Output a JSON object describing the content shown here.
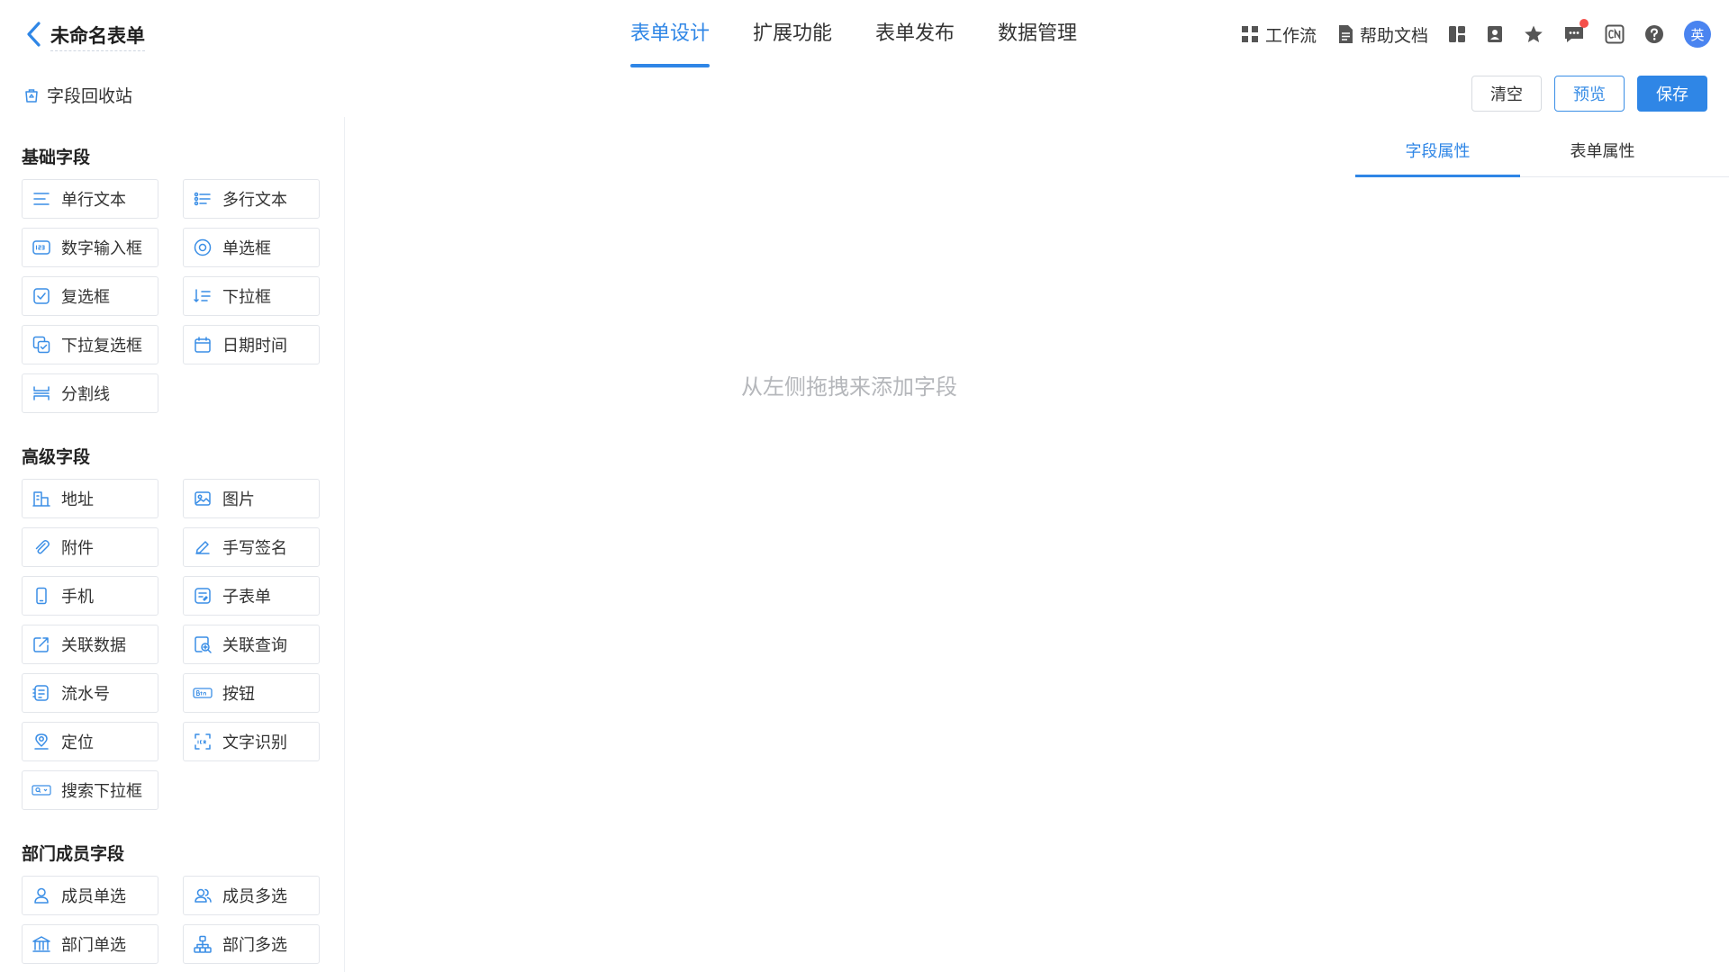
{
  "header": {
    "title": "未命名表单",
    "tabs": [
      "表单设计",
      "扩展功能",
      "表单发布",
      "数据管理"
    ],
    "active_tab": 0,
    "tools": {
      "workflow": "工作流",
      "help_docs": "帮助文档",
      "avatar_text": "英"
    }
  },
  "recycle": {
    "label": "字段回收站"
  },
  "actions": {
    "clear": "清空",
    "preview": "预览",
    "save": "保存"
  },
  "sidebar": {
    "basic_title": "基础字段",
    "basic": [
      {
        "label": "单行文本",
        "icon": "single-line-text-icon"
      },
      {
        "label": "多行文本",
        "icon": "multi-line-text-icon"
      },
      {
        "label": "数字输入框",
        "icon": "number-input-icon"
      },
      {
        "label": "单选框",
        "icon": "radio-icon"
      },
      {
        "label": "复选框",
        "icon": "checkbox-icon"
      },
      {
        "label": "下拉框",
        "icon": "dropdown-icon"
      },
      {
        "label": "下拉复选框",
        "icon": "dropdown-multi-icon"
      },
      {
        "label": "日期时间",
        "icon": "calendar-icon"
      },
      {
        "label": "分割线",
        "icon": "divider-icon"
      }
    ],
    "advanced_title": "高级字段",
    "advanced": [
      {
        "label": "地址",
        "icon": "address-icon"
      },
      {
        "label": "图片",
        "icon": "image-icon"
      },
      {
        "label": "附件",
        "icon": "attachment-icon"
      },
      {
        "label": "手写签名",
        "icon": "signature-icon"
      },
      {
        "label": "手机",
        "icon": "phone-icon"
      },
      {
        "label": "子表单",
        "icon": "subform-icon"
      },
      {
        "label": "关联数据",
        "icon": "linked-data-icon"
      },
      {
        "label": "关联查询",
        "icon": "linked-query-icon"
      },
      {
        "label": "流水号",
        "icon": "serial-number-icon"
      },
      {
        "label": "按钮",
        "icon": "button-icon"
      },
      {
        "label": "定位",
        "icon": "location-icon"
      },
      {
        "label": "文字识别",
        "icon": "ocr-icon"
      },
      {
        "label": "搜索下拉框",
        "icon": "search-dropdown-icon"
      }
    ],
    "dept_title": "部门成员字段",
    "dept": [
      {
        "label": "成员单选",
        "icon": "member-single-icon"
      },
      {
        "label": "成员多选",
        "icon": "member-multi-icon"
      },
      {
        "label": "部门单选",
        "icon": "dept-single-icon"
      },
      {
        "label": "部门多选",
        "icon": "dept-multi-icon"
      }
    ]
  },
  "canvas": {
    "placeholder": "从左侧拖拽来添加字段"
  },
  "panel": {
    "tabs": [
      "字段属性",
      "表单属性"
    ],
    "active_tab": 0
  },
  "colors": {
    "accent": "#2f86e6",
    "badge": "#f5504b",
    "avatar": "#4a84f0"
  }
}
